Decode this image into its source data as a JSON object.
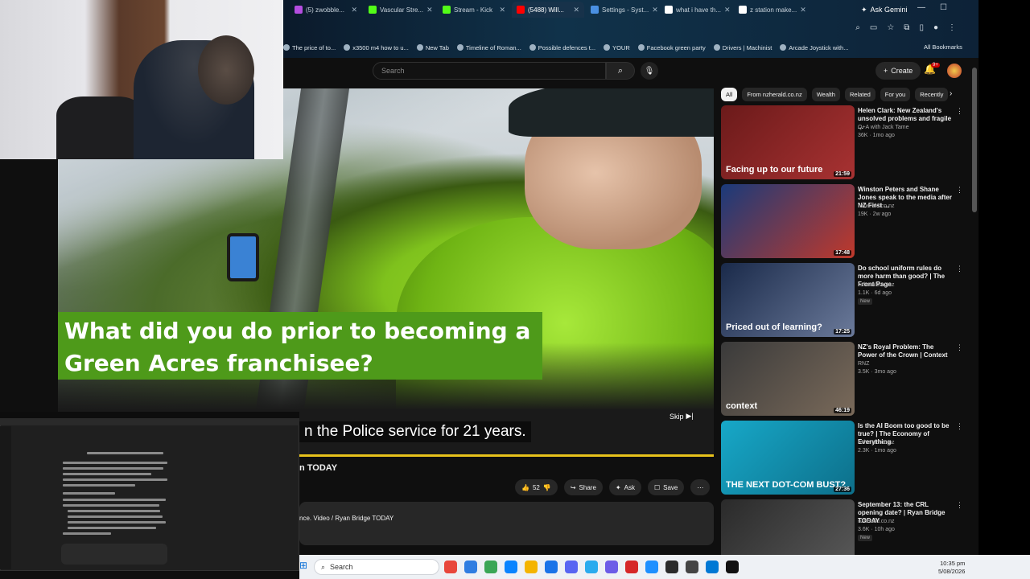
{
  "browser": {
    "tabs": [
      {
        "label": "(5) zwobble...",
        "color": "#b44de0",
        "active": false
      },
      {
        "label": "Vascular Stre...",
        "color": "#53fc18",
        "active": false
      },
      {
        "label": "Stream - Kick",
        "color": "#53fc18",
        "active": false
      },
      {
        "label": "(5488) Will...",
        "color": "#ff0000",
        "active": true
      },
      {
        "label": "Settings - Syst...",
        "color": "#4a90e2",
        "active": false
      },
      {
        "label": "what i have th...",
        "color": "#ffffff",
        "active": false
      },
      {
        "label": "z station make...",
        "color": "#ffffff",
        "active": false
      }
    ],
    "ask_gemini": "Ask Gemini",
    "bookmarks": [
      "The price of to...",
      "x3500 m4 how to u...",
      "New Tab",
      "Timeline of Roman...",
      "Possible defences t...",
      "YOUR",
      "Facebook green party",
      "Drivers | Machinist",
      "Arcade Joystick with..."
    ],
    "all_bookmarks": "All Bookmarks"
  },
  "youtube": {
    "search_placeholder": "Search",
    "create_label": "Create",
    "notif_count": "9+",
    "video": {
      "caption": "What did you do prior to becoming a Green Acres franchisee?",
      "subtitle": "n the Police service for 21 years.",
      "skip_label": "Skip",
      "title": "n TODAY",
      "description": "nce. Video / Ryan Bridge TODAY",
      "progress_color": "#e7c21b"
    },
    "actions": {
      "likes": "52",
      "share": "Share",
      "ask": "Ask",
      "save": "Save"
    },
    "chips": [
      "All",
      "From nzherald.co.nz",
      "Wealth",
      "Related",
      "For you",
      "Recently"
    ],
    "recommendations": [
      {
        "title": "Helen Clark: New Zealand's unsolved problems and fragile ...",
        "channel": "Q+A with Jack Tame",
        "meta": "36K · 1mo ago",
        "duration": "21:59",
        "thumb_text": "Facing up to our future",
        "badge": "",
        "colors": [
          "#6b1a1a",
          "#a83232"
        ]
      },
      {
        "title": "Winston Peters and Shane Jones speak to the media after NZ First ...",
        "channel": "nzherald.co.nz",
        "meta": "19K · 2w ago",
        "duration": "17:48",
        "thumb_text": "",
        "badge": "",
        "colors": [
          "#1a3a7a",
          "#c0392b"
        ]
      },
      {
        "title": "Do school uniform rules do more harm than good? | The Front Page",
        "channel": "nzherald.co.nz",
        "meta": "1.1K · 6d ago",
        "duration": "17:25",
        "thumb_text": "Priced out of learning?",
        "badge": "New",
        "colors": [
          "#1a2a4a",
          "#6b7a9a"
        ]
      },
      {
        "title": "NZ's Royal Problem: The Power of the Crown | Context",
        "channel": "RNZ",
        "meta": "3.5K · 3mo ago",
        "duration": "46:19",
        "thumb_text": "context",
        "badge": "",
        "colors": [
          "#3a3a3a",
          "#7a6a5a"
        ]
      },
      {
        "title": "Is the AI Boom too good to be true? | The Economy of Everything",
        "channel": "nzherald.co.nz",
        "meta": "2.3K · 1mo ago",
        "duration": "27:36",
        "thumb_text": "THE NEXT DOT-COM BUST?",
        "badge": "",
        "colors": [
          "#17a8c8",
          "#0d6f8a"
        ]
      },
      {
        "title": "September 13: the CRL opening date? | Ryan Bridge TODAY",
        "channel": "nzherald.co.nz",
        "meta": "3.6K · 10h ago",
        "duration": "",
        "thumb_text": "",
        "badge": "New",
        "colors": [
          "#2a2a2a",
          "#5a5a5a"
        ]
      }
    ]
  },
  "taskbar": {
    "search_placeholder": "Search",
    "time": "10:35 pm",
    "date": "5/08/2026"
  }
}
